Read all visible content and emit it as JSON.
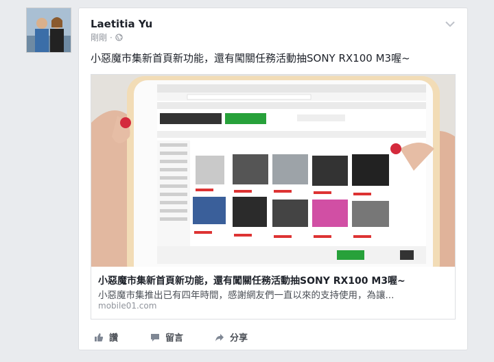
{
  "post": {
    "author": "Laetitia Yu",
    "time": "剛剛",
    "separator": "·",
    "message": "小惡魔市集新首頁新功能，還有闖關任務活動抽SONY RX100 M3喔~"
  },
  "link": {
    "title": "小惡魔市集新首頁新功能，還有闖關任務活動抽SONY RX100 M3喔~",
    "description": "小惡魔市集推出已有四年時間，感謝網友們一直以來的支持使用，為讓...",
    "domain": "mobile01.com"
  },
  "actions": {
    "like_label": "讚",
    "comment_label": "留言",
    "share_label": "分享"
  },
  "colors": {
    "page_bg": "#e9ebee",
    "card_bg": "#ffffff",
    "text_primary": "#1d2129",
    "text_secondary": "#90949c",
    "action_text": "#4b4f56",
    "ipad_frame": "#f2dcb6"
  },
  "icons": {
    "privacy": "globe-icon",
    "menu": "chevron-down-icon",
    "like": "thumbs-up-icon",
    "comment": "comment-bubble-icon",
    "share": "share-arrow-icon"
  }
}
